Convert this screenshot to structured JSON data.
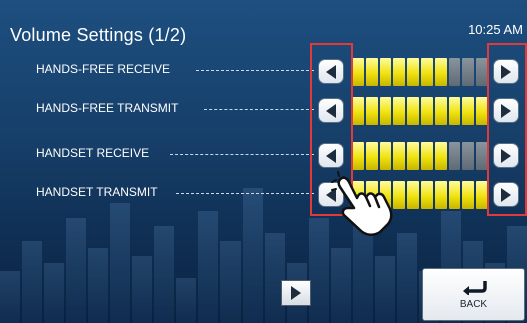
{
  "header": {
    "title": "Volume Settings (1/2)",
    "time": "10:25 AM"
  },
  "settings": [
    {
      "label": "HANDS-FREE RECEIVE",
      "level": 7,
      "max": 10
    },
    {
      "label": "HANDS-FREE TRANSMIT",
      "level": 10,
      "max": 10
    },
    {
      "label": "HANDSET RECEIVE",
      "level": 7,
      "max": 10
    },
    {
      "label": "HANDSET TRANSMIT",
      "level": 10,
      "max": 10
    }
  ],
  "footer": {
    "back_label": "BACK"
  },
  "icons": {
    "decrease": "left-triangle-icon",
    "increase": "right-triangle-icon",
    "next_page": "right-triangle-icon",
    "back": "return-arrow-icon",
    "pointer": "hand-pointer-icon"
  },
  "colors": {
    "level_on": "#f0e20f",
    "level_off": "#6b7680",
    "highlight": "#e23a3a"
  }
}
